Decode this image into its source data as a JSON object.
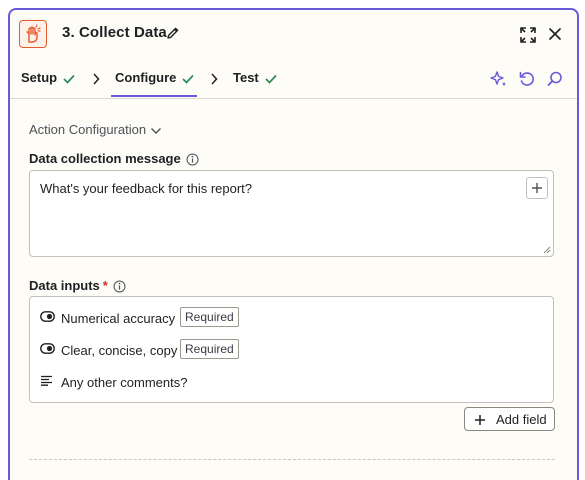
{
  "header": {
    "title": "3. Collect Data",
    "icons": [
      "app-hand-icon",
      "pencil-icon",
      "expand-icon",
      "close-icon"
    ]
  },
  "tabs": [
    {
      "label": "Setup",
      "complete": true
    },
    {
      "label": "Configure",
      "complete": true,
      "active": true
    },
    {
      "label": "Test",
      "complete": true
    }
  ],
  "toolbar_icons": [
    "ai-sparkle-icon",
    "refresh-icon",
    "search-icon"
  ],
  "section": {
    "label": "Action Configuration"
  },
  "message_field": {
    "label": "Data collection message",
    "value": "What's your feedback for this report?"
  },
  "data_inputs": {
    "label": "Data inputs",
    "required_marker": "*",
    "items": [
      {
        "label": "Numerical accuracy",
        "icon": "toggle-icon",
        "badge": "Required"
      },
      {
        "label": "Clear, concise, copy",
        "icon": "toggle-icon",
        "badge": "Required"
      },
      {
        "label": "Any other comments?",
        "icon": "text-lines-icon"
      }
    ]
  },
  "add_field_button": {
    "label": "Add field"
  },
  "colors": {
    "accent": "#6a5ad8",
    "success": "#2e8b57",
    "brand": "#e25c2c",
    "required": "#d92d20"
  }
}
